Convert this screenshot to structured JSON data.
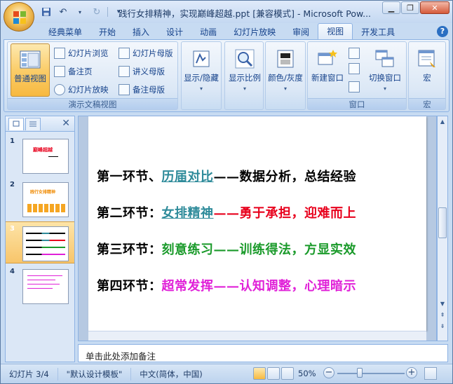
{
  "window": {
    "title": "践行女排精神，实现巅峰超越.ppt [兼容模式] - Microsoft Pow..."
  },
  "ribbon_tabs": [
    {
      "label": "经典菜单"
    },
    {
      "label": "开始"
    },
    {
      "label": "插入"
    },
    {
      "label": "设计"
    },
    {
      "label": "动画"
    },
    {
      "label": "幻灯片放映"
    },
    {
      "label": "审阅"
    },
    {
      "label": "视图"
    },
    {
      "label": "开发工具"
    }
  ],
  "active_tab": "视图",
  "ribbon": {
    "presentation_views": {
      "group_label": "演示文稿视图",
      "normal_view": "普通视图",
      "slide_sorter": "幻灯片浏览",
      "notes_page": "备注页",
      "slide_show": "幻灯片放映",
      "slide_master": "幻灯片母版",
      "handout_master": "讲义母版",
      "notes_master": "备注母版"
    },
    "show_hide": "显示/隐藏",
    "zoom": "显示比例",
    "color_gray": "颜色/灰度",
    "window_group": {
      "group_label": "窗口",
      "new_window": "新建窗口",
      "switch_window": "切换窗口"
    },
    "macros_group": {
      "group_label": "宏",
      "macros": "宏"
    }
  },
  "slides_panel": {
    "thumbnails": [
      {
        "number": "1",
        "title_text": "巅峰超越"
      },
      {
        "number": "2",
        "title_text": "践行女排精神"
      },
      {
        "number": "3"
      },
      {
        "number": "4"
      }
    ],
    "selected": "3"
  },
  "slide": {
    "lines": [
      {
        "prefix": "第一环节、",
        "highlight": "历届对比",
        "rest": "——数据分析，总结经验",
        "prefix_color": "#000000",
        "highlight_color": "#2e8b9a",
        "rest_color": "#000000",
        "underline": true
      },
      {
        "prefix": "第二环节：",
        "highlight": "女排精神",
        "rest": "——勇于承担，迎难而上",
        "prefix_color": "#000000",
        "highlight_color": "#2e8b9a",
        "rest_color": "#e8001c",
        "underline": true
      },
      {
        "prefix": "第三环节：",
        "highlight": "刻意练习",
        "rest": "——训练得法，方显实效",
        "prefix_color": "#000000",
        "highlight_color": "#1a9a2a",
        "rest_color": "#1a9a2a",
        "underline": false
      },
      {
        "prefix": "第四环节：",
        "highlight": "超常发挥",
        "rest": "——认知调整，心理暗示",
        "prefix_color": "#000000",
        "highlight_color": "#e020d8",
        "rest_color": "#e020d8",
        "underline": false
      }
    ]
  },
  "notes": {
    "placeholder": "单击此处添加备注"
  },
  "status": {
    "slide_info": "幻灯片 3/4",
    "template": "\"默认设计模板\"",
    "language": "中文(简体，中国)",
    "zoom": "50%",
    "zoom_level": 0.5
  },
  "colors": {
    "accent": "#f7b940",
    "ribbon_bg": "#dce8f6",
    "frame": "#8db2e3"
  }
}
